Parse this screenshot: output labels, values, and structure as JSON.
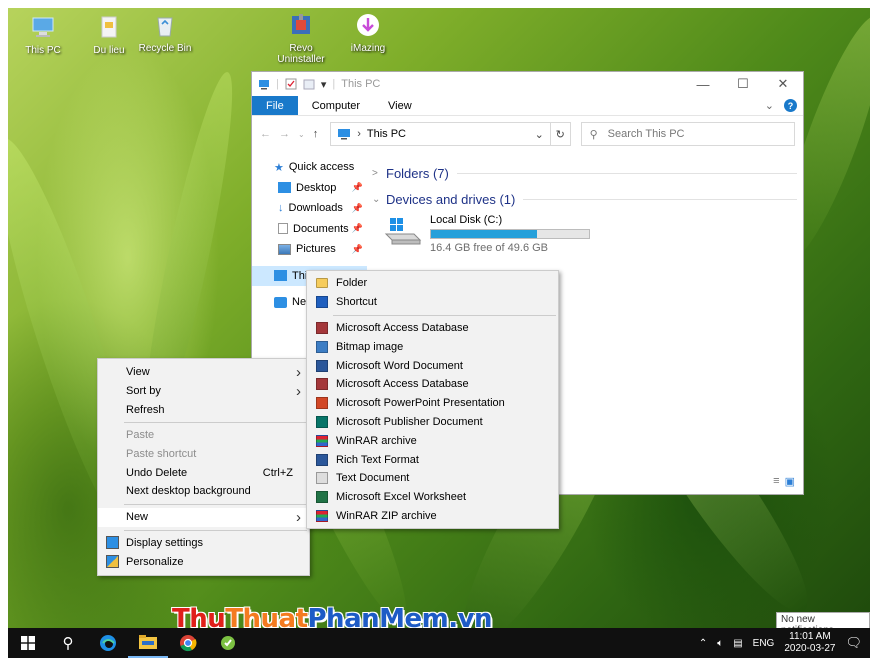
{
  "desktop": {
    "icons": [
      {
        "label": "This PC",
        "icon": "computer-icon"
      },
      {
        "label": "Du lieu",
        "icon": "folder-icon"
      },
      {
        "label": "Recycle Bin",
        "icon": "recycle-bin-icon"
      },
      {
        "label": "Revo Uninstaller",
        "icon": "revo-uninstaller-icon"
      },
      {
        "label": "iMazing",
        "icon": "imazing-icon"
      }
    ]
  },
  "explorer": {
    "title": "This PC",
    "ribbon_tabs": [
      "File",
      "Computer",
      "View"
    ],
    "address": "This PC",
    "search_placeholder": "Search This PC",
    "nav": [
      {
        "label": "Quick access",
        "icon": "star-icon",
        "pinned": false
      },
      {
        "label": "Desktop",
        "icon": "desktop-icon",
        "pinned": true
      },
      {
        "label": "Downloads",
        "icon": "download-icon",
        "pinned": true
      },
      {
        "label": "Documents",
        "icon": "document-icon",
        "pinned": true
      },
      {
        "label": "Pictures",
        "icon": "pictures-icon",
        "pinned": true
      },
      {
        "label": "This",
        "icon": "computer-icon",
        "pinned": false
      },
      {
        "label": "Net",
        "icon": "network-icon",
        "pinned": false
      }
    ],
    "groups": {
      "folders": "Folders (7)",
      "devices": "Devices and drives (1)"
    },
    "drive": {
      "name": "Local Disk (C:)",
      "free_text": "16.4 GB free of 49.6 GB",
      "used_fraction": 0.67
    }
  },
  "context_menu": {
    "items": [
      {
        "label": "View",
        "submenu": true,
        "disabled": false
      },
      {
        "label": "Sort by",
        "submenu": true,
        "disabled": false
      },
      {
        "label": "Refresh",
        "disabled": false
      },
      {
        "sep": true
      },
      {
        "label": "Paste",
        "disabled": true
      },
      {
        "label": "Paste shortcut",
        "disabled": true
      },
      {
        "label": "Undo Delete",
        "shortcut": "Ctrl+Z",
        "disabled": false
      },
      {
        "label": "Next desktop background",
        "disabled": false
      },
      {
        "sep": true
      },
      {
        "label": "New",
        "submenu": true,
        "disabled": false,
        "hover": true
      },
      {
        "sep": true
      },
      {
        "label": "Display settings",
        "icon": "display-settings-icon",
        "disabled": false
      },
      {
        "label": "Personalize",
        "icon": "personalize-icon",
        "disabled": false
      }
    ]
  },
  "new_menu": {
    "items": [
      {
        "label": "Folder",
        "icon": "folder-icon",
        "color": "#f6cc5c"
      },
      {
        "label": "Shortcut",
        "icon": "shortcut-icon",
        "color": "#1f5fbf"
      },
      {
        "sep": true
      },
      {
        "label": "Microsoft Access Database",
        "icon": "access-icon",
        "color": "#a4373a"
      },
      {
        "label": "Bitmap image",
        "icon": "bitmap-icon",
        "color": "#3c7dc4"
      },
      {
        "label": "Microsoft Word Document",
        "icon": "word-icon",
        "color": "#2b579a"
      },
      {
        "label": "Microsoft Access Database",
        "icon": "access-icon",
        "color": "#a4373a"
      },
      {
        "label": "Microsoft PowerPoint Presentation",
        "icon": "powerpoint-icon",
        "color": "#d24726"
      },
      {
        "label": "Microsoft Publisher Document",
        "icon": "publisher-icon",
        "color": "#077568"
      },
      {
        "label": "WinRAR archive",
        "icon": "winrar-icon",
        "color": "#8b2c6e"
      },
      {
        "label": "Rich Text Format",
        "icon": "rtf-icon",
        "color": "#2b579a"
      },
      {
        "label": "Text Document",
        "icon": "text-document-icon",
        "color": "#dddddd"
      },
      {
        "label": "Microsoft Excel Worksheet",
        "icon": "excel-icon",
        "color": "#217346"
      },
      {
        "label": "WinRAR ZIP archive",
        "icon": "winrar-zip-icon",
        "color": "#8b2c6e"
      }
    ]
  },
  "taskbar": {
    "lang": "ENG",
    "time": "11:01 AM",
    "date": "2020-03-27",
    "notification_tooltip": "No new notifications"
  },
  "watermark": {
    "part1": "Thu",
    "part2": "Thuat",
    "part3": "PhanMem",
    "part4": ".vn"
  }
}
